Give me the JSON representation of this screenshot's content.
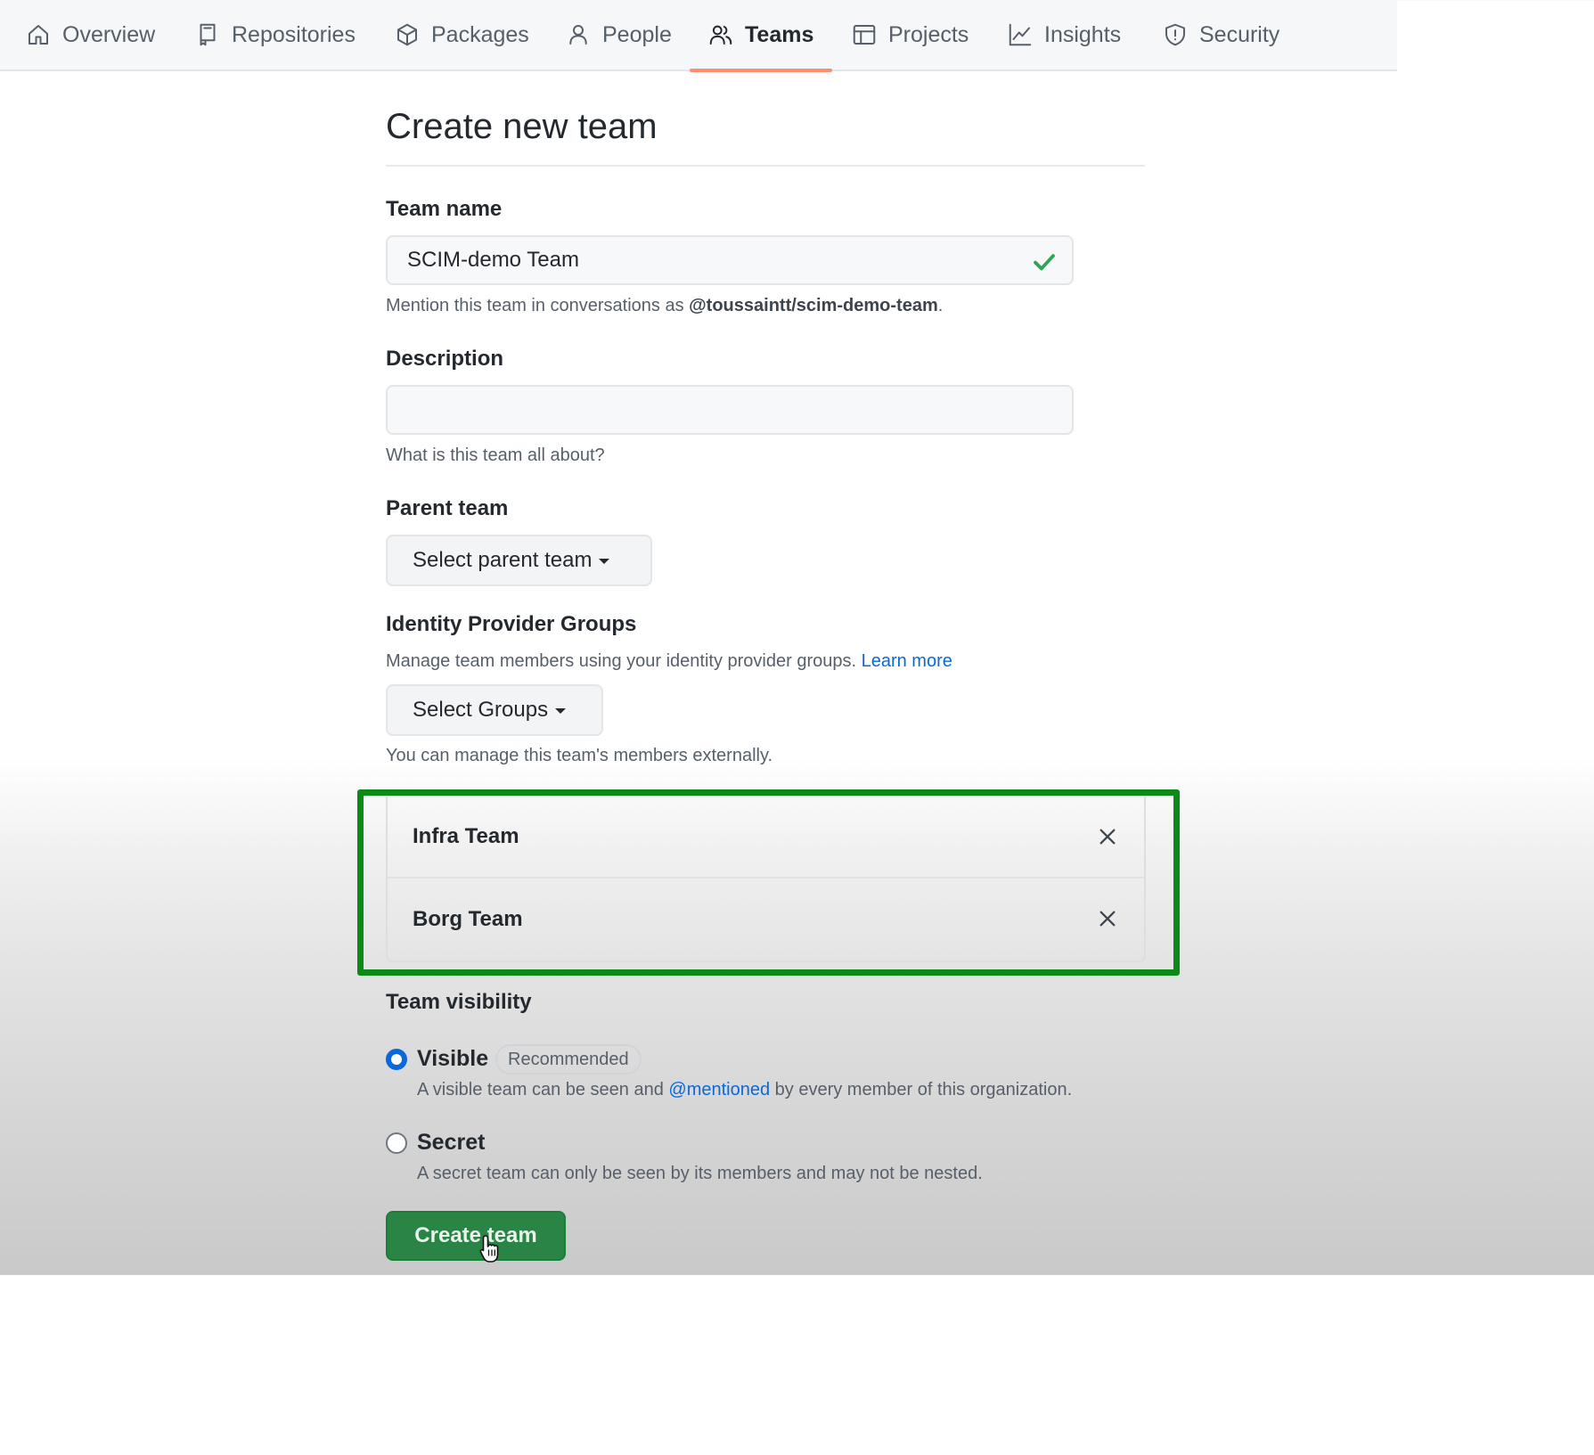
{
  "nav": {
    "items": [
      {
        "label": "Overview",
        "icon": "home-icon"
      },
      {
        "label": "Repositories",
        "icon": "repo-icon"
      },
      {
        "label": "Packages",
        "icon": "package-icon"
      },
      {
        "label": "People",
        "icon": "person-icon"
      },
      {
        "label": "Teams",
        "icon": "people-icon",
        "active": true
      },
      {
        "label": "Projects",
        "icon": "table-icon"
      },
      {
        "label": "Insights",
        "icon": "graph-icon"
      },
      {
        "label": "Security",
        "icon": "shield-icon"
      }
    ]
  },
  "page": {
    "title": "Create new team"
  },
  "team_name": {
    "label": "Team name",
    "value": "SCIM-demo Team",
    "hint_prefix": "Mention this team in conversations as ",
    "hint_handle": "@toussaintt/scim-demo-team",
    "hint_suffix": "."
  },
  "description": {
    "label": "Description",
    "value": "",
    "hint": "What is this team all about?"
  },
  "parent_team": {
    "label": "Parent team",
    "button": "Select parent team"
  },
  "idp_groups": {
    "label": "Identity Provider Groups",
    "hint": "Manage team members using your identity provider groups. ",
    "learn_more": "Learn more",
    "button": "Select Groups",
    "note": "You can manage this team's members externally.",
    "selected": [
      {
        "name": "Infra Team"
      },
      {
        "name": "Borg Team"
      }
    ]
  },
  "visibility": {
    "label": "Team visibility",
    "selected": "visible",
    "visible": {
      "label": "Visible",
      "badge": "Recommended",
      "desc_prefix": "A visible team can be seen and ",
      "desc_link": "@mentioned",
      "desc_suffix": " by every member of this organization."
    },
    "secret": {
      "label": "Secret",
      "desc": "A secret team can only be seen by its members and may not be nested."
    }
  },
  "submit": {
    "label": "Create team"
  },
  "colors": {
    "accent_link": "#0969da",
    "active_tab_underline": "#fd8c73",
    "primary_button": "#2a8446",
    "highlight_box": "#0c8a17",
    "valid_check": "#2da44e"
  }
}
